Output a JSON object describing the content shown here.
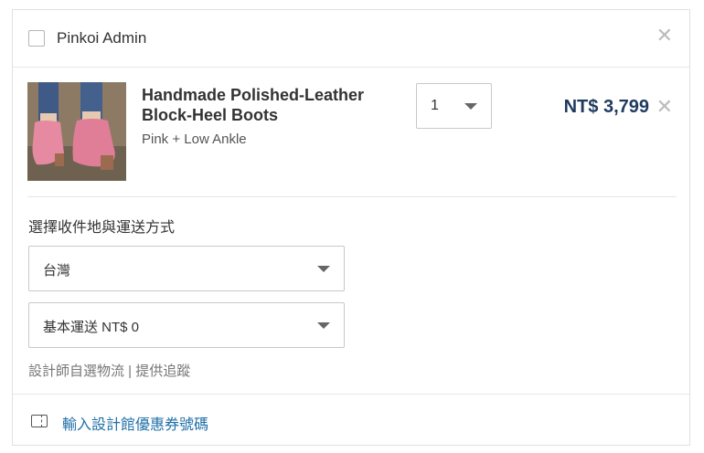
{
  "header": {
    "shop_name": "Pinkoi Admin",
    "close_icon": "close-icon"
  },
  "item": {
    "title": "Handmade Polished-Leather Block-Heel Boots",
    "variant": "Pink + Low Ankle",
    "quantity": "1",
    "price": "NT$ 3,799",
    "price_color": "#1f3a5f"
  },
  "shipping": {
    "label": "選擇收件地與運送方式",
    "country": "台灣",
    "method": "基本運送 NT$ 0",
    "note": "設計師自選物流 | 提供追蹤"
  },
  "footer": {
    "coupon_label": "輸入設計館優惠券號碼",
    "link_color": "#1f6fa8"
  }
}
